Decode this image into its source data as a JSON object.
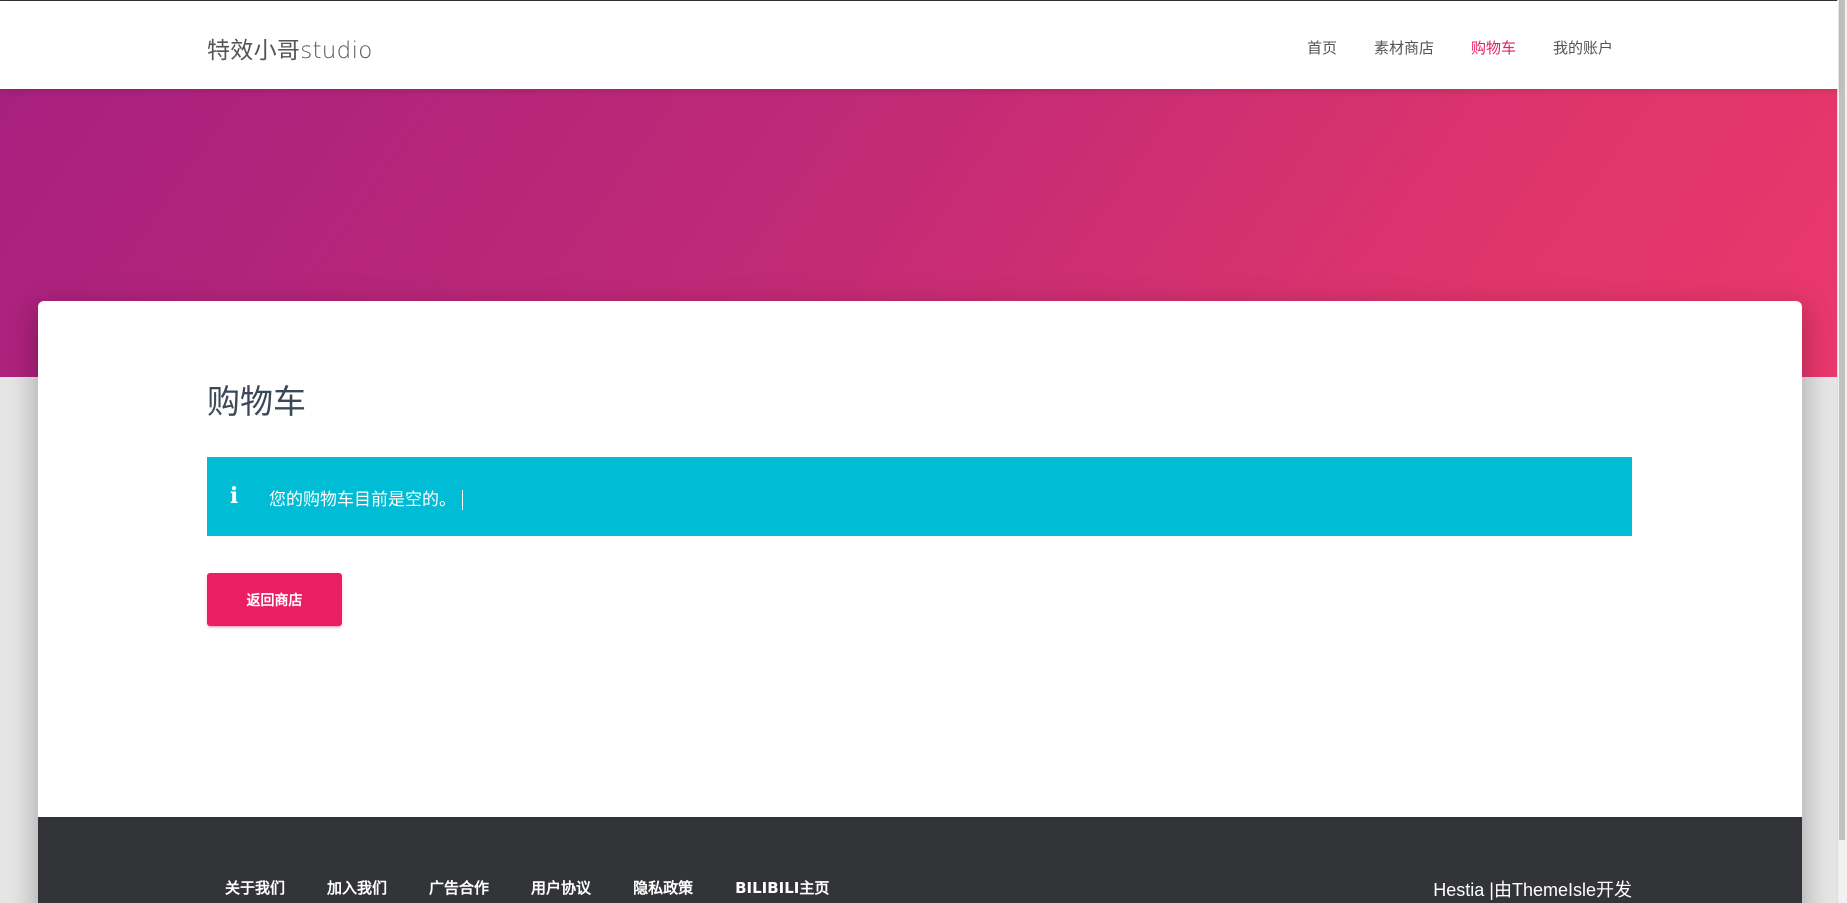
{
  "navbar": {
    "brand": "特效小哥studio",
    "links": [
      {
        "label": "首页",
        "active": false
      },
      {
        "label": "素材商店",
        "active": false
      },
      {
        "label": "购物车",
        "active": true
      },
      {
        "label": "我的账户",
        "active": false
      }
    ]
  },
  "hero": {
    "gradient_start": "#a8207f",
    "gradient_end": "#ea386c"
  },
  "main": {
    "title": "购物车",
    "notice": {
      "icon": "info-icon",
      "text": "您的购物车目前是空的。",
      "background": "#00bcd4"
    },
    "return_button": {
      "label": "返回商店",
      "color": "#e91e63"
    }
  },
  "footer": {
    "links": [
      "关于我们",
      "加入我们",
      "广告合作",
      "用户协议",
      "隐私政策",
      "BILIBILI主页"
    ],
    "credit": "Hestia |由ThemeIsle开发",
    "background": "#323437"
  }
}
